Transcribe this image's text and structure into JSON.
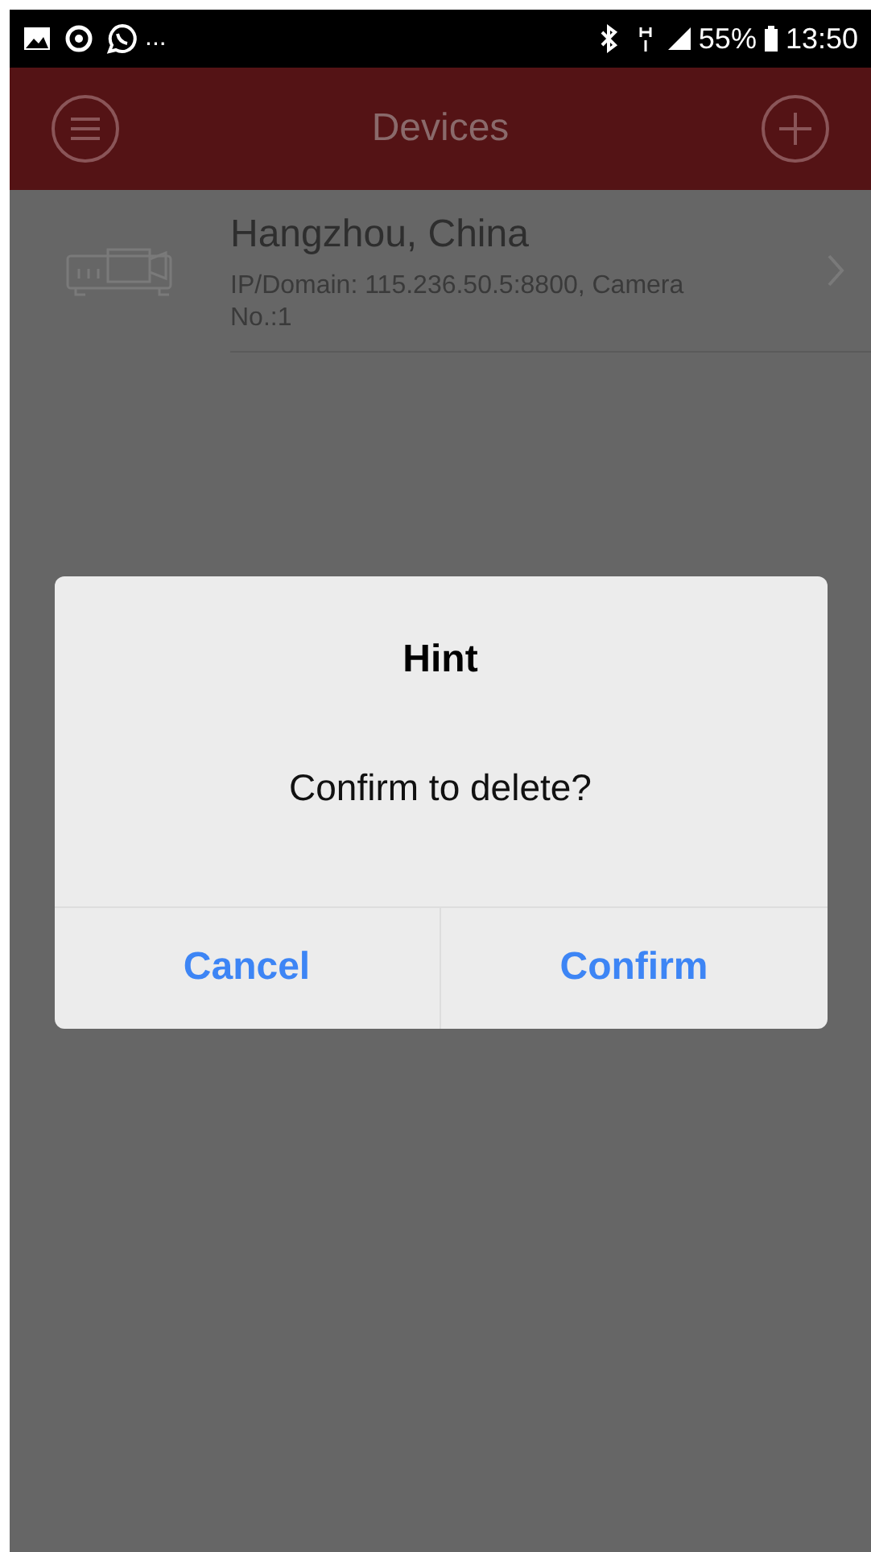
{
  "status_bar": {
    "more": "...",
    "battery": "55%",
    "time": "13:50"
  },
  "header": {
    "title": "Devices"
  },
  "devices": [
    {
      "name": "Hangzhou, China",
      "details": "IP/Domain: 115.236.50.5:8800, Camera No.:1"
    }
  ],
  "dialog": {
    "title": "Hint",
    "message": "Confirm to delete?",
    "buttons": [
      "Cancel",
      "Confirm"
    ]
  }
}
